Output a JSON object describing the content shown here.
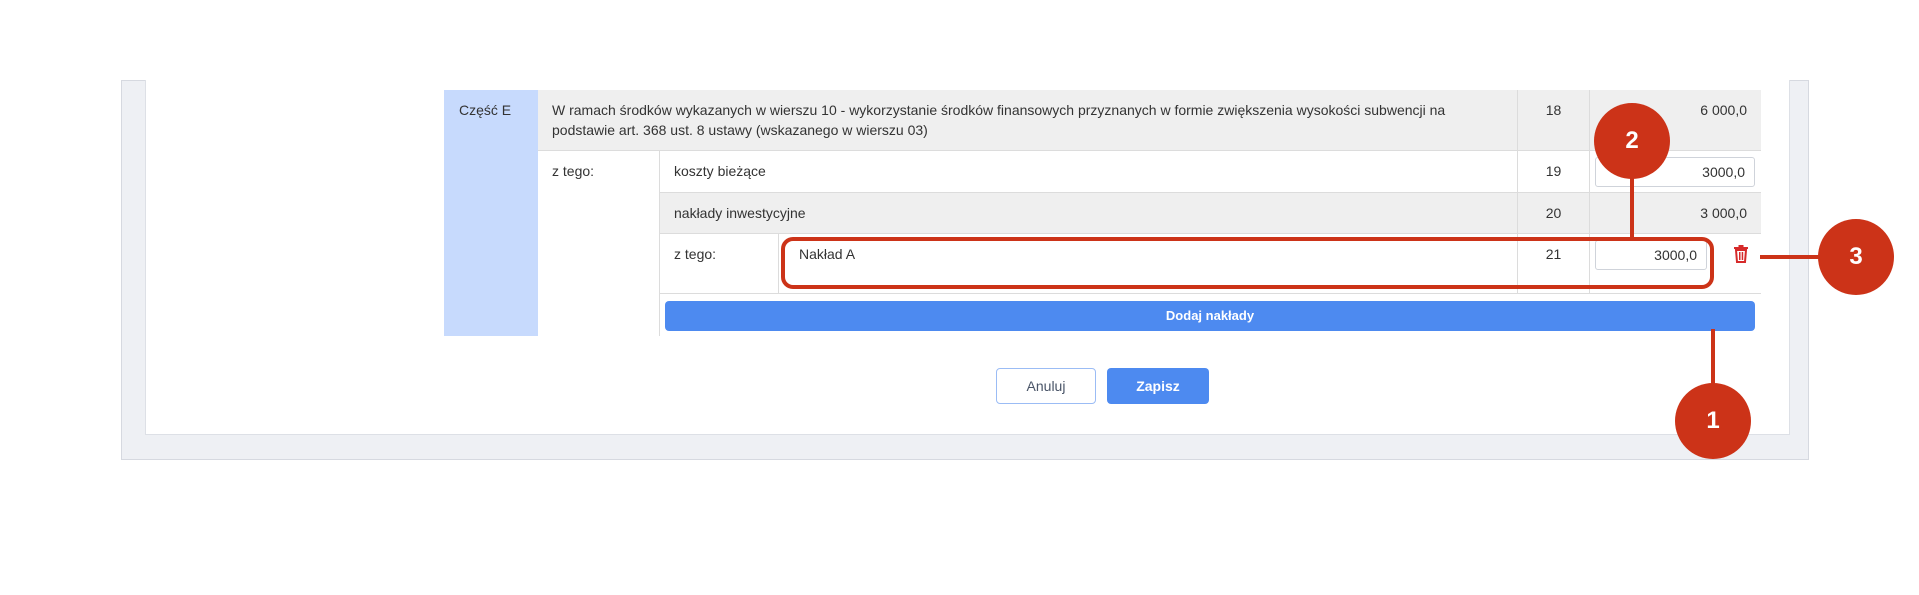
{
  "table": {
    "section_label": "Część E",
    "row18": {
      "description": "W ramach środków wykazanych w wierszu 10 - wykorzystanie środków finansowych przyznanych w formie zwiększenia wysokości subwencji na podstawie art. 368 ust. 8 ustawy (wskazanego w wierszu 03)",
      "number": "18",
      "value": "6 000,0"
    },
    "z_tego_label": "z tego:",
    "row19": {
      "label": "koszty bieżące",
      "number": "19",
      "value": "3000,0"
    },
    "row20": {
      "label": "nakłady inwestycyjne",
      "number": "20",
      "value": "3 000,0"
    },
    "row21": {
      "label": "z tego:",
      "name_value": "Nakład A",
      "number": "21",
      "value": "3000,0"
    },
    "add_button_label": "Dodaj nakłady"
  },
  "actions": {
    "cancel_label": "Anuluj",
    "save_label": "Zapisz"
  },
  "callouts": {
    "one": "1",
    "two": "2",
    "three": "3"
  },
  "icons": {
    "delete": "trash-icon"
  },
  "colors": {
    "accent_blue": "#4d8af0",
    "section_blue": "#c7dafd",
    "callout_red": "#cc3318",
    "delete_red": "#d62a2a"
  }
}
